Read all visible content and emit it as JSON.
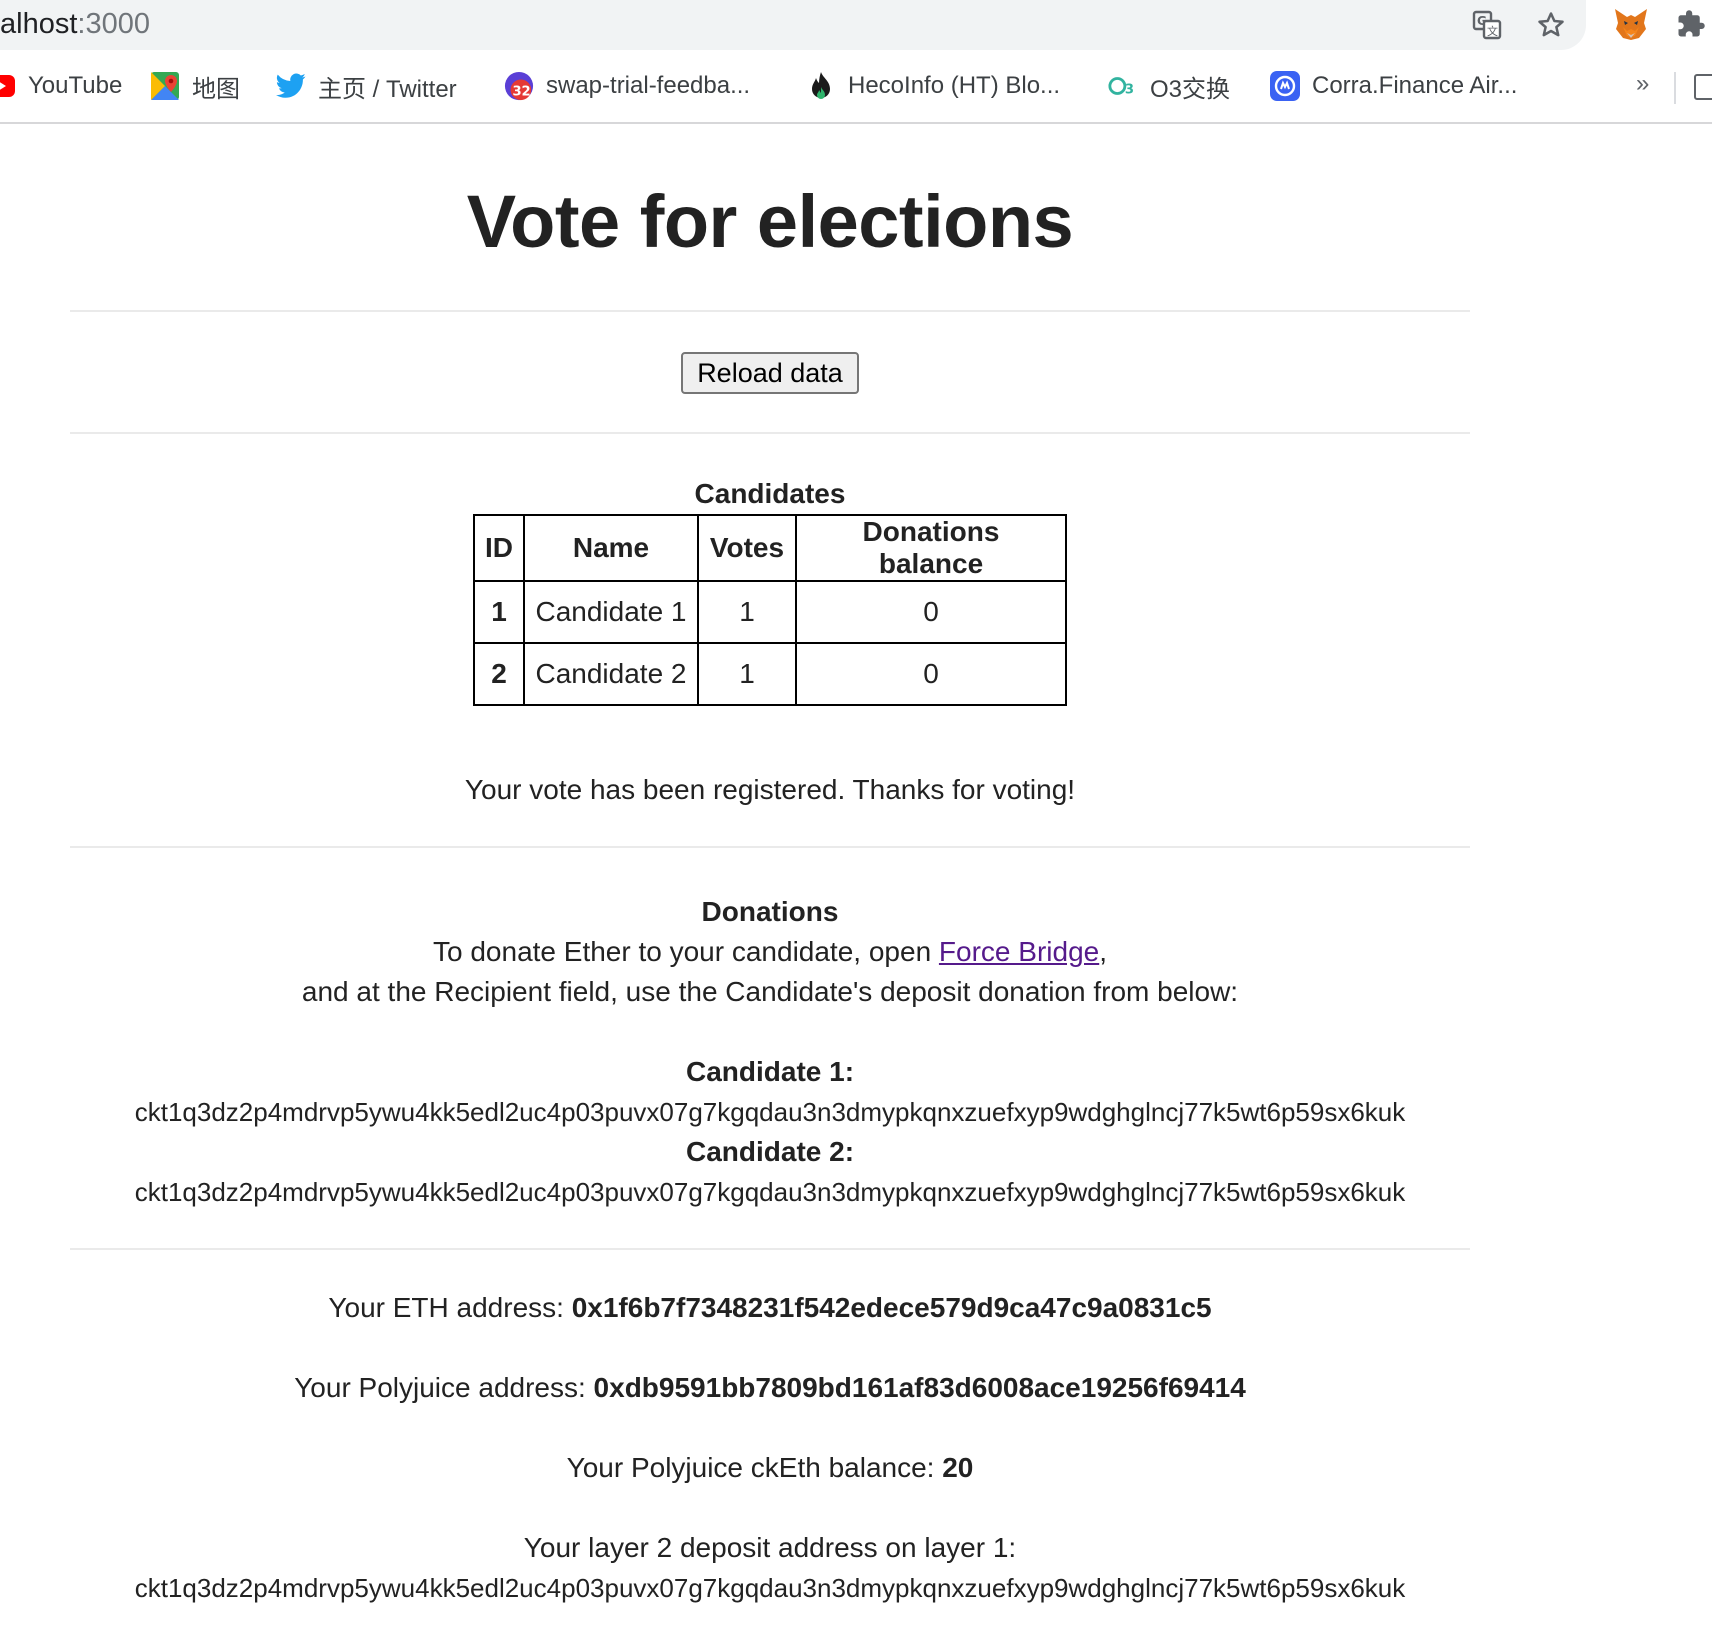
{
  "browser": {
    "url_host": "alhost",
    "url_port": ":3000",
    "bookmarks": [
      {
        "label": "YouTube",
        "icon": "youtube-icon"
      },
      {
        "label": "地图",
        "icon": "google-maps-icon"
      },
      {
        "label": "主页 / Twitter",
        "icon": "twitter-icon"
      },
      {
        "label": "swap-trial-feedba...",
        "icon": "badge-32-icon",
        "badge": "32"
      },
      {
        "label": "HecoInfo (HT) Blo...",
        "icon": "flame-icon"
      },
      {
        "label": "O3交换",
        "icon": "o3-icon"
      },
      {
        "label": "Corra.Finance Air...",
        "icon": "corra-icon"
      }
    ],
    "more_label": "»"
  },
  "page": {
    "title": "Vote for elections",
    "reload_button": "Reload data",
    "table": {
      "caption": "Candidates",
      "headers": [
        "ID",
        "Name",
        "Votes",
        "Donations balance"
      ],
      "rows": [
        {
          "id": "1",
          "name": "Candidate 1",
          "votes": "1",
          "donations": "0"
        },
        {
          "id": "2",
          "name": "Candidate 2",
          "votes": "1",
          "donations": "0"
        }
      ]
    },
    "vote_message": "Your vote has been registered. Thanks for voting!",
    "donations": {
      "title": "Donations",
      "line1_prefix": "To donate Ether to your candidate, open ",
      "link": "Force Bridge",
      "line1_suffix": ",",
      "line2": "and at the Recipient field, use the Candidate's deposit donation from below:",
      "candidates": [
        {
          "label": "Candidate 1:",
          "address": "ckt1q3dz2p4mdrvp5ywu4kk5edl2uc4p03puvx07g7kgqdau3n3dmypkqnxzuefxyp9wdghglncj77k5wt6p59sx6kuk"
        },
        {
          "label": "Candidate 2:",
          "address": "ckt1q3dz2p4mdrvp5ywu4kk5edl2uc4p03puvx07g7kgqdau3n3dmypkqnxzuefxyp9wdghglncj77k5wt6p59sx6kuk"
        }
      ]
    },
    "account": {
      "eth_label": "Your ETH address: ",
      "eth_value": "0x1f6b7f7348231f542edece579d9ca47c9a0831c5",
      "poly_label": "Your Polyjuice address: ",
      "poly_value": "0xdb9591bb7809bd161af83d6008ace19256f69414",
      "balance_label": "Your Polyjuice ckEth balance: ",
      "balance_value": "20",
      "deposit_label": "Your layer 2 deposit address on layer 1:",
      "deposit_value": "ckt1q3dz2p4mdrvp5ywu4kk5edl2uc4p03puvx07g7kgqdau3n3dmypkqnxzuefxyp9wdghglncj77k5wt6p59sx6kuk"
    }
  },
  "colors": {
    "link": "#551a8b",
    "omnibox_bg": "#f1f3f4"
  }
}
